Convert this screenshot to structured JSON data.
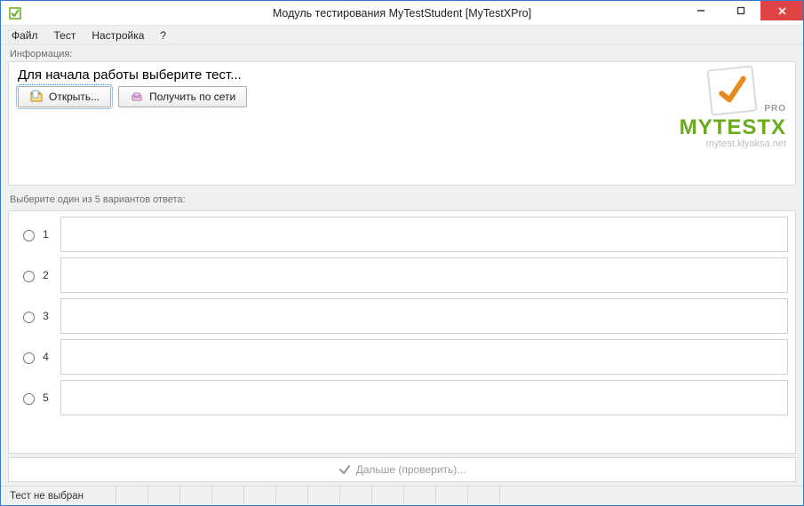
{
  "window": {
    "title": "Модуль тестирования MyTestStudent [MyTestXPro]"
  },
  "menu": {
    "file": "Файл",
    "test": "Тест",
    "settings": "Настройка",
    "help": "?"
  },
  "info": {
    "group_label": "Информация:",
    "prompt": "Для начала работы выберите тест...",
    "open_label": "Открыть...",
    "network_label": "Получить по сети"
  },
  "logo": {
    "pro": "PRO",
    "name": "MYTESTX",
    "sub": "mytest.klyaksa.net"
  },
  "answers": {
    "group_label": "Выберите один из 5 вариантов ответа:",
    "items": [
      {
        "num": "1",
        "text": ""
      },
      {
        "num": "2",
        "text": ""
      },
      {
        "num": "3",
        "text": ""
      },
      {
        "num": "4",
        "text": ""
      },
      {
        "num": "5",
        "text": ""
      }
    ]
  },
  "next": {
    "label": "Дальше (проверить)..."
  },
  "status": {
    "text": "Тест не выбран"
  }
}
